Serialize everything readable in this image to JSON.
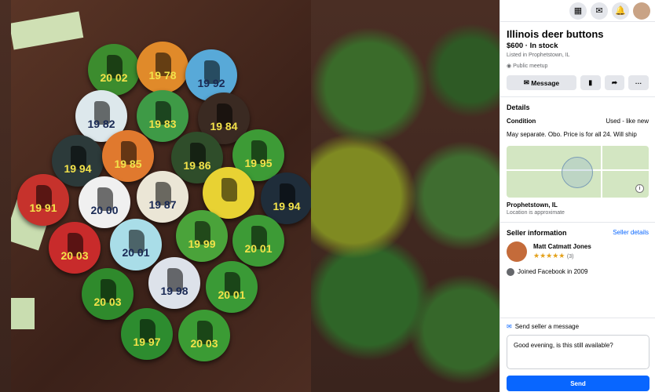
{
  "listing": {
    "title": "Illinois deer buttons",
    "price": "$600 · In stock",
    "listed": "Listed in Prophetstown, IL",
    "meetup": "Public meetup"
  },
  "actions": {
    "message": "Message"
  },
  "details": {
    "heading": "Details",
    "condition_label": "Condition",
    "condition_value": "Used - like new",
    "description": "May separate. Obo. Price is for all 24. Will ship"
  },
  "location": {
    "name": "Prophetstown, IL",
    "note": "Location is approximate"
  },
  "seller": {
    "heading": "Seller information",
    "details_link": "Seller details",
    "name": "Matt Catmatt Jones",
    "rating": "★★★★★",
    "rating_count": "(3)",
    "joined": "Joined Facebook in 2009"
  },
  "message": {
    "heading": "Send seller a message",
    "text": "Good evening, is this still available?",
    "send": "Send"
  },
  "icons": {
    "apps": "grid-icon",
    "messenger": "messenger-icon",
    "notifications": "bell-icon"
  },
  "buttons": [
    {
      "year": "20 02",
      "color": "#3c8c2e"
    },
    {
      "year": "19 78",
      "color": "#e08a2a"
    },
    {
      "year": "19 92",
      "color": "#58a9d8"
    },
    {
      "year": "19 82",
      "color": "#dde8ec"
    },
    {
      "year": "19 83",
      "color": "#3e9a46"
    },
    {
      "year": "19 84",
      "color": "#3a2a22"
    },
    {
      "year": "19 94",
      "color": "#2c3a3a"
    },
    {
      "year": "19 85",
      "color": "#e0792e"
    },
    {
      "year": "19 86",
      "color": "#2f4d2a"
    },
    {
      "year": "19 95",
      "color": "#3d9b36"
    },
    {
      "year": "19 91",
      "color": "#c6322c"
    },
    {
      "year": "20 00",
      "color": "#f0f0f0"
    },
    {
      "year": "19 87",
      "color": "#ebe6d6"
    },
    {
      "year": "",
      "color": "#e8d233"
    },
    {
      "year": "19 94",
      "color": "#1f2d3a"
    },
    {
      "year": "20 03",
      "color": "#c82b2b"
    },
    {
      "year": "20 01",
      "color": "#a9dde8"
    },
    {
      "year": "19 99",
      "color": "#4aa33a"
    },
    {
      "year": "20 01",
      "color": "#3d9b36"
    },
    {
      "year": "20 03",
      "color": "#2f8a2c"
    },
    {
      "year": "19 98",
      "color": "#dde2ea"
    },
    {
      "year": "20 01",
      "color": "#3a9a36"
    },
    {
      "year": "19 97",
      "color": "#2d8c2f"
    },
    {
      "year": "20 03",
      "color": "#3b9b34"
    }
  ]
}
